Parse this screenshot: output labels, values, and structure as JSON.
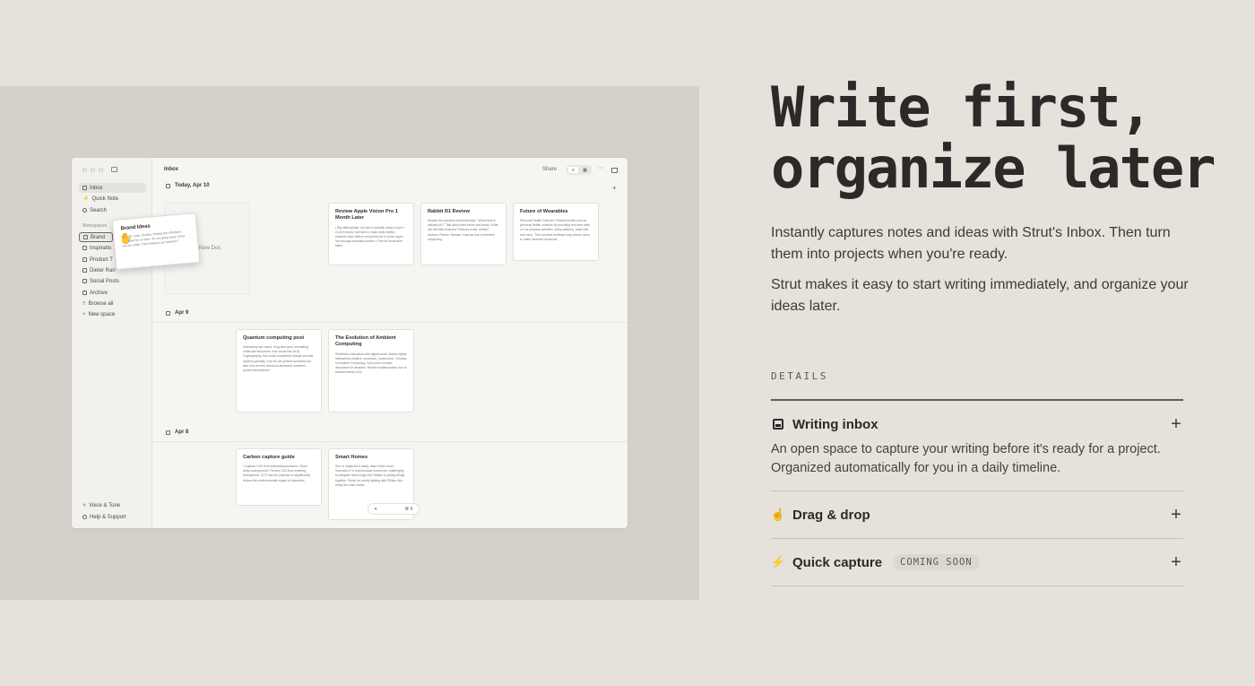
{
  "headline": {
    "line1": "Write first,",
    "line2": "organize later"
  },
  "intro": {
    "p1": "Instantly captures notes and ideas with Strut's Inbox. Then turn them into projects when you're ready.",
    "p2": "Strut makes it easy to start writing immediately, and organize your ideas later."
  },
  "details": {
    "label": "DETAILS",
    "items": [
      {
        "icon": "inbox-icon",
        "title": "Writing inbox",
        "expanded": true,
        "body": "An open space to capture your writing before it's ready for a project. Organized automatically for you in a daily timeline."
      },
      {
        "icon": "hand-pointer-icon",
        "title": "Drag & drop",
        "expanded": false
      },
      {
        "icon": "bolt-icon",
        "title": "Quick capture",
        "badge": "COMING SOON",
        "expanded": false
      }
    ]
  },
  "app": {
    "sidebar": {
      "items": [
        "Inbox",
        "Quick Note",
        "Search"
      ],
      "workspaces_label": "Workspaces",
      "spaces": [
        "Brand",
        "Inspiratio",
        "Product T",
        "Dieter Ran",
        "Social Posts",
        "Archive",
        "Browse all",
        "New space"
      ],
      "footer": [
        "Voice & Tone",
        "Help & Support"
      ]
    },
    "topbar": {
      "title": "Inbox",
      "share": "Share"
    },
    "days": [
      "Today, Apr 10",
      "Apr 9",
      "Apr 8"
    ],
    "new_doc": "New Doc",
    "drag_card": {
      "title": "Brand Ideas",
      "text": "Warmth, ease, flexible, Writing feel effortless. Designed for an idea. It's not going away. What can we make it feel timeless yet futuristic?"
    },
    "cards": [
      {
        "title": "Review Apple Vision Pro 1 Month Later",
        "text": "• Big initial splash, but who's actually using it now? • Cool in theory but hard to make daily habits • Headset does deliver real presence in some apps • Not enough essential content • Fine for immersive tasks"
      },
      {
        "title": "Rabbit R1 Review",
        "text": "Answer the question everyone asks: \"What does it actually do?\" Talk about form factor and setup. What are the killer features? Discuss rivals, related devices. Revive. Hamper. Discuss rise of ambient computing."
      },
      {
        "title": "Future of Wearables",
        "text": "Personal Health Coaches. Fitness trackers act as personal health coaches by providing real-time data on our physical activities, sleep patterns, heart rate, and more. This constant feedback loop allows users to make informed decisions."
      },
      {
        "title": "Quantum computing post",
        "text": "Interesting use cases: drug discovery, simulating molecular structures, how would this do AI. Cryptography, this could completely change security systems globally. How do we protect ourselves but also how do less technical advanced countries protect themselves?"
      },
      {
        "title": "The Evolution of Ambient Computing",
        "text": "Redefines interaction with digital world. Makes digital interactions intuitive, seamless, unobtrusive. Genesis of Ambient Computing. Not a new concept, discussed for decades. Recent miniaturization due to advancements in AI."
      },
      {
        "title": "Carbon capture guide",
        "text": "• Capture CO2 from industrial processes • Store deep underground. Prevent CO2 from entering atmosphere. CCS has the potential to significantly reduce the environmental impact of industries."
      },
      {
        "title": "Smart Homes",
        "text": "Sort of neglected it lately, hasn't been much innovation? Is that because homes are challenging to integrate technology into? Matter is pulling things together. Study for mostly lighting with Philips Hue being the main leader."
      }
    ]
  }
}
